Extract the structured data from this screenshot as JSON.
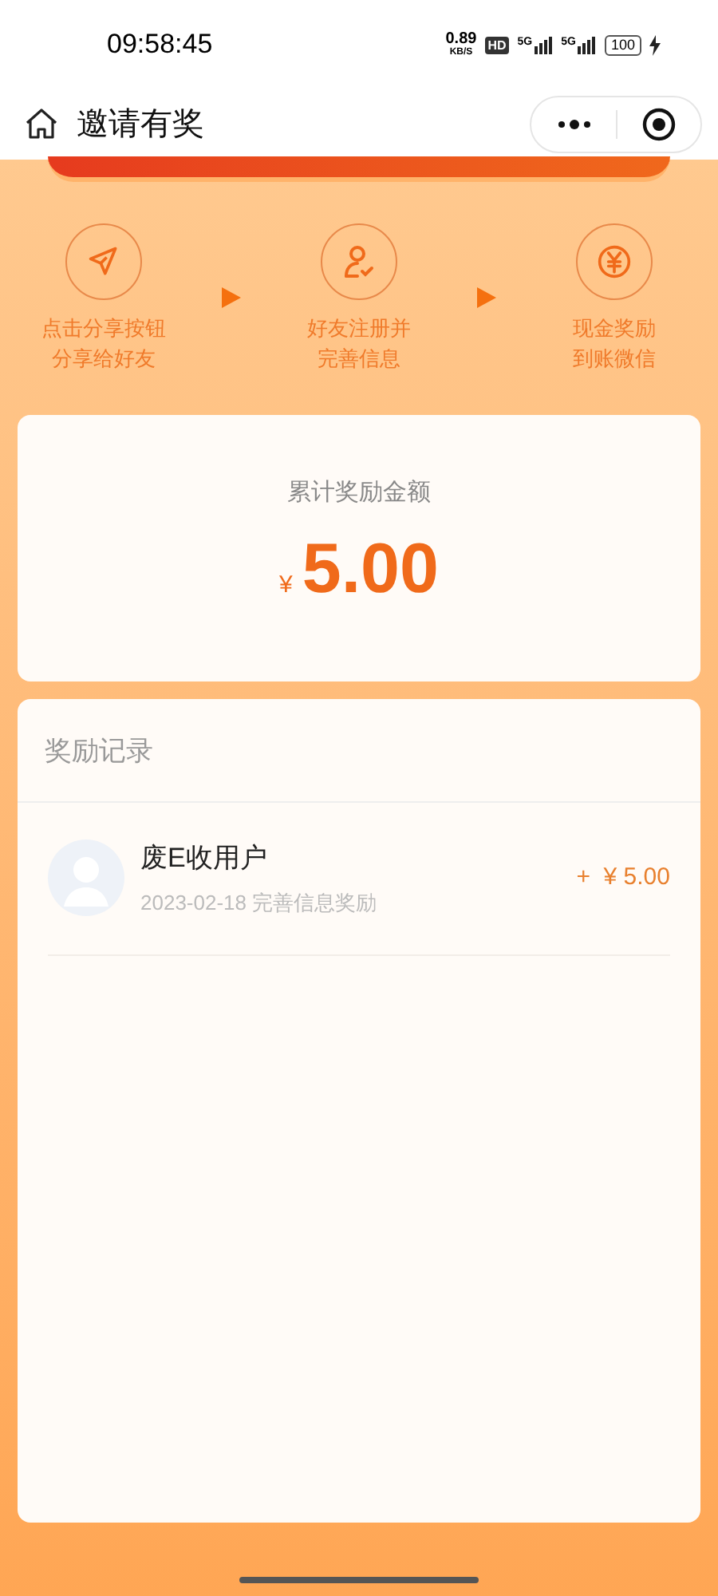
{
  "status_bar": {
    "time": "09:58:45",
    "speed_value": "0.89",
    "speed_unit": "KB/S",
    "hd": "HD",
    "networks": [
      "5G",
      "5G"
    ],
    "battery": "100"
  },
  "nav": {
    "title": "邀请有奖"
  },
  "steps": [
    {
      "kind": "share",
      "lines": [
        "点击分享按钮",
        "分享给好友"
      ]
    },
    {
      "kind": "register",
      "lines": [
        "好友注册并",
        "完善信息"
      ]
    },
    {
      "kind": "reward",
      "lines": [
        "现金奖励",
        "到账微信"
      ]
    }
  ],
  "total": {
    "label": "累计奖励金额",
    "currency": "¥",
    "amount": "5.00"
  },
  "records": {
    "title": "奖励记录",
    "items": [
      {
        "name": "废E收用户",
        "date": "2023-02-18",
        "desc": "完善信息奖励",
        "amount": "+  ¥ 5.00"
      }
    ]
  }
}
